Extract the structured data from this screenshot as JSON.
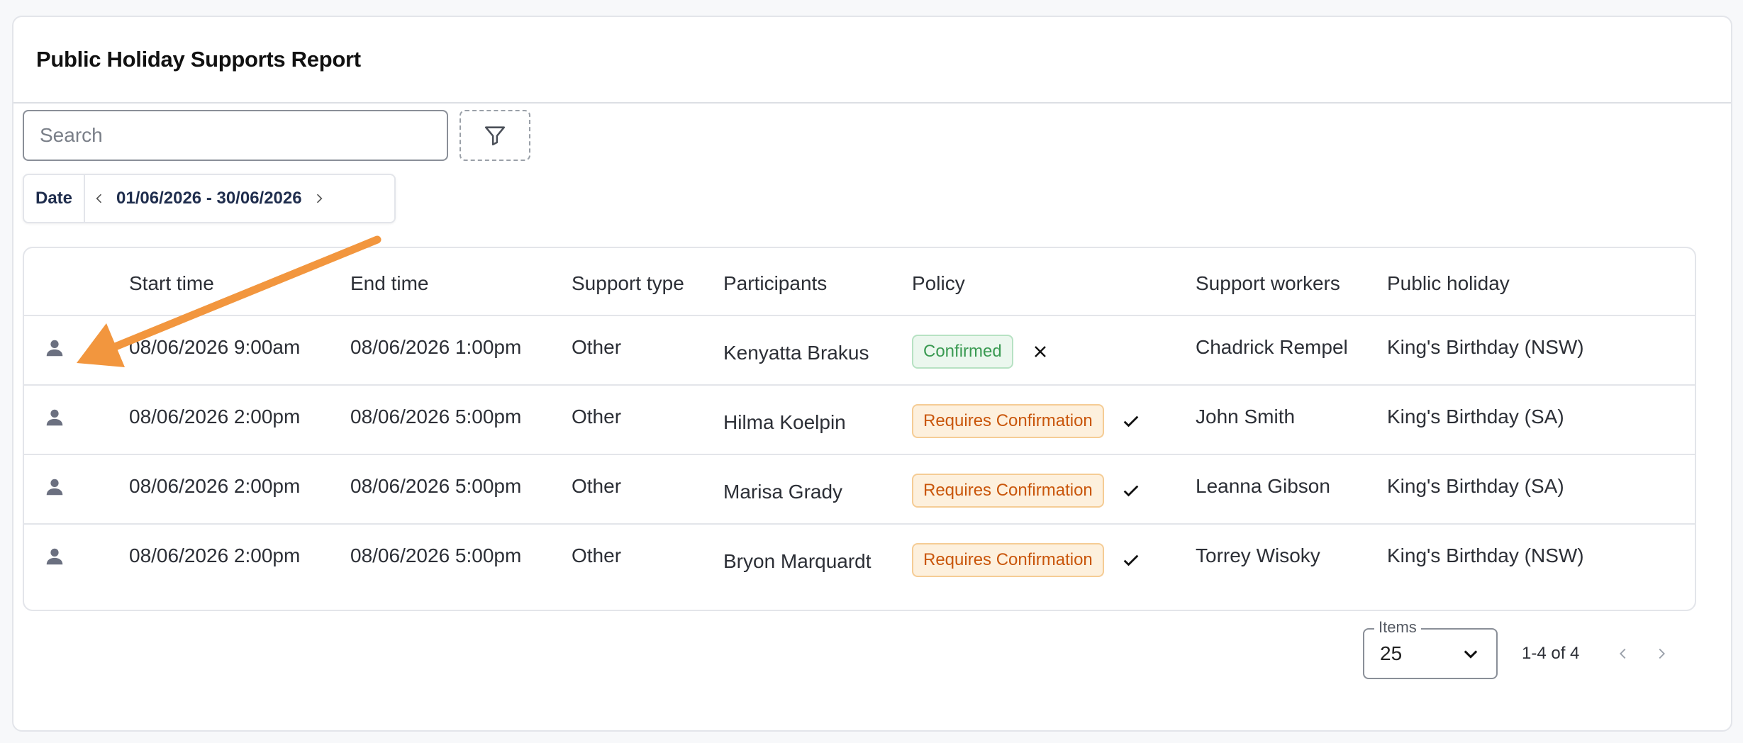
{
  "report": {
    "title": "Public Holiday Supports Report"
  },
  "search": {
    "placeholder": "Search"
  },
  "date_filter": {
    "label": "Date",
    "range": "01/06/2026 - 30/06/2026"
  },
  "table": {
    "headers": {
      "start": "Start time",
      "end": "End time",
      "type": "Support type",
      "participants": "Participants",
      "policy": "Policy",
      "workers": "Support workers",
      "holiday": "Public holiday"
    },
    "rows": [
      {
        "start": "08/06/2026 9:00am",
        "end": "08/06/2026 1:00pm",
        "type": "Other",
        "participant": "Kenyatta Brakus",
        "policy": "Confirmed",
        "policy_status": "confirmed",
        "action_icon": "close-icon",
        "worker": "Chadrick Rempel",
        "holiday": "King's Birthday (NSW)"
      },
      {
        "start": "08/06/2026 2:00pm",
        "end": "08/06/2026 5:00pm",
        "type": "Other",
        "participant": "Hilma Koelpin",
        "policy": "Requires Confirmation",
        "policy_status": "requires",
        "action_icon": "check-icon",
        "worker": "John Smith",
        "holiday": "King's Birthday (SA)"
      },
      {
        "start": "08/06/2026 2:00pm",
        "end": "08/06/2026 5:00pm",
        "type": "Other",
        "participant": "Marisa Grady",
        "policy": "Requires Confirmation",
        "policy_status": "requires",
        "action_icon": "check-icon",
        "worker": "Leanna Gibson",
        "holiday": "King's Birthday (SA)"
      },
      {
        "start": "08/06/2026 2:00pm",
        "end": "08/06/2026 5:00pm",
        "type": "Other",
        "participant": "Bryon Marquardt",
        "policy": "Requires Confirmation",
        "policy_status": "requires",
        "action_icon": "check-icon",
        "worker": "Torrey Wisoky",
        "holiday": "King's Birthday (NSW)"
      }
    ]
  },
  "pagination": {
    "items_label": "Items",
    "items_value": "25",
    "range_text": "1-4 of 4"
  },
  "colors": {
    "annotation_arrow": "#f2963e",
    "confirmed": "#3a9a52",
    "requires": "#c9560b"
  }
}
